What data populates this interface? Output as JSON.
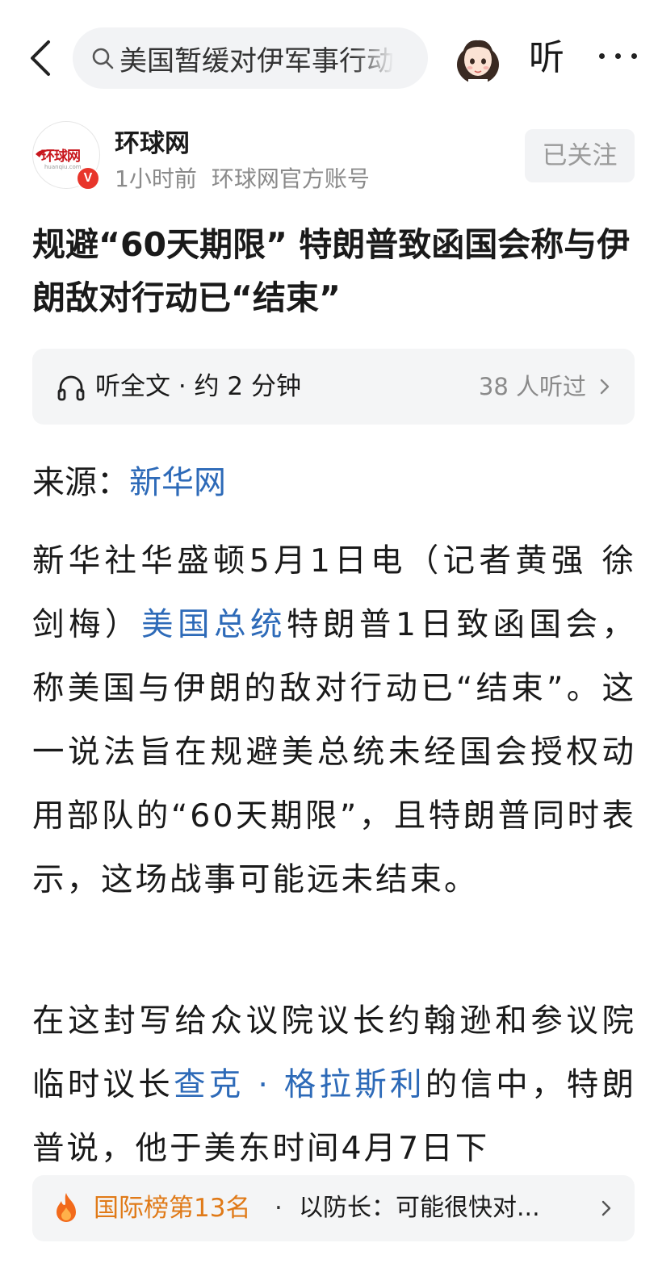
{
  "header": {
    "search_text": "美国暂缓对伊军事行动",
    "listen_label": "听"
  },
  "author": {
    "logo_text": "环球网",
    "logo_url_text": "huanqiu.com",
    "verified_badge": "V",
    "name": "环球网",
    "time": "1小时前",
    "account_desc": "环球网官方账号",
    "follow_label": "已关注"
  },
  "article": {
    "title": "规避“60天期限” 特朗普致函国会称与伊朗敌对行动已“结束”",
    "listen": {
      "label": "听全文 · 约 2 分钟",
      "count": "38 人听过"
    },
    "source_label": "来源：",
    "source_link": "新华网",
    "p1_a": "新华社华盛顿5月1日电（记者黄强 徐剑梅）",
    "p1_link": "美国总统",
    "p1_b": "特朗普1日致函国会，称美国与伊朗的敌对行动已“结束”。这一说法旨在规避美总统未经国会授权动用部队的“60天期限”，且特朗普同时表示，这场战事可能远未结束。",
    "p2_a": "在这封写给众议院议长约翰逊和参议院临时议长",
    "p2_link": "查克 · 格拉斯利",
    "p2_b": "的信中，特朗普说，他于美东时间4月7日下"
  },
  "ranking": {
    "rank_label": "国际榜第13名",
    "separator": "·",
    "headline": "以防长：可能很快对..."
  },
  "colors": {
    "link": "#2d6ab8",
    "rank": "#e07a18",
    "badge": "#e8352b",
    "logo_red": "#c8161d"
  },
  "icons": [
    "back-arrow-icon",
    "search-icon",
    "avatar",
    "more-icon",
    "headphones-icon",
    "chevron-right-icon",
    "fire-icon"
  ]
}
